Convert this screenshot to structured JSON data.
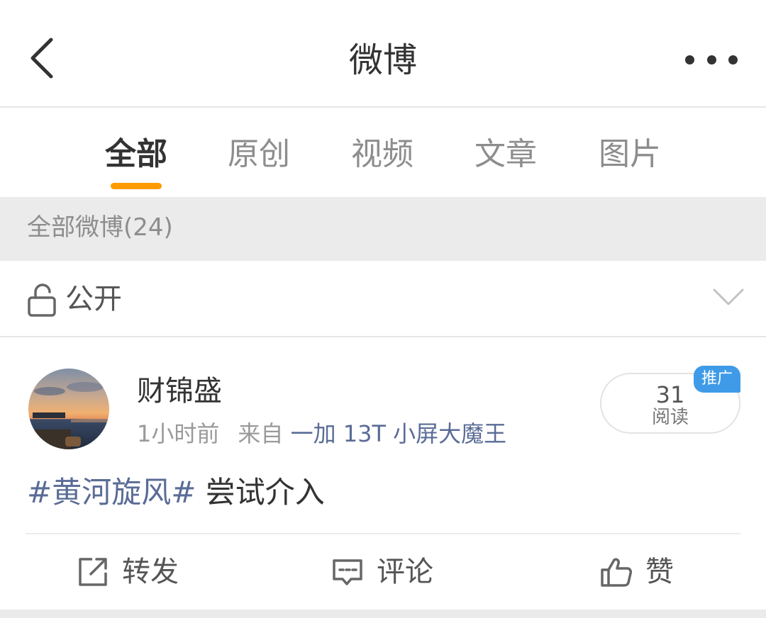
{
  "header": {
    "title": "微博"
  },
  "tabs": [
    {
      "label": "全部",
      "active": true
    },
    {
      "label": "原创",
      "active": false
    },
    {
      "label": "视频",
      "active": false
    },
    {
      "label": "文章",
      "active": false
    },
    {
      "label": "图片",
      "active": false
    }
  ],
  "count_bar": {
    "text": "全部微博(24)"
  },
  "visibility": {
    "label": "公开",
    "icon": "unlock-icon",
    "dropdown_icon": "chevron-down-icon"
  },
  "post": {
    "author": "财锦盛",
    "time": "1小时前",
    "source_prefix": "来自",
    "device": "一加 13T 小屏大魔王",
    "read_count": "31",
    "read_label": "阅读",
    "promo_tag": "推广",
    "topic": "#黄河旋风#",
    "text": " 尝试介入",
    "actions": {
      "repost_label": "转发",
      "comment_label": "评论",
      "like_label": "赞"
    }
  },
  "colors": {
    "accent": "#ff9a00",
    "link": "#5a6c96",
    "promo": "#3f9be8"
  }
}
